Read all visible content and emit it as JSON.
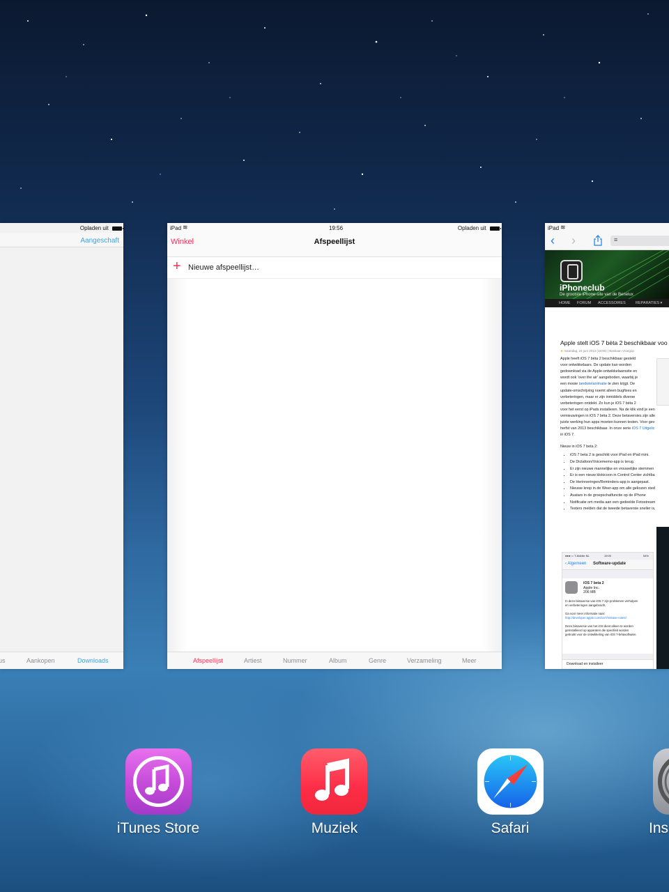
{
  "cards": {
    "itunes": {
      "status_right": "Opladen uit",
      "nav_right": "Aangeschaft",
      "tabs": [
        "us",
        "Aankopen",
        "Downloads"
      ]
    },
    "music": {
      "status_left": "iPad",
      "status_time": "19:56",
      "status_right": "Opladen uit",
      "nav_left": "Winkel",
      "nav_title": "Afspeellijst",
      "new_playlist": "Nieuwe afspeellijst…",
      "tabs": [
        "Afspeellijst",
        "Artiest",
        "Nummer",
        "Album",
        "Genre",
        "Verzameling",
        "Meer"
      ],
      "active_color": "#ff2d55"
    },
    "safari": {
      "status_left": "iPad",
      "site_name": "iPhoneclub",
      "site_tagline": "De grootste iPhone-site van de Benelux",
      "menu": [
        "HOME",
        "FORUM",
        "ACCESSOIRES",
        "REPARATIES ▾"
      ],
      "article_title": "Apple stelt iOS 7 bèta 2 beschikbaar voo",
      "article_meta": "maandag, 24 juni 2013 (18:56) | Bastiaan Vroegop",
      "paragraph_lines": [
        "Apple heeft iOS 7 bèta 2 beschikbaar gesteld",
        "voor ontwikkelaars. De update kan worden",
        "gedownload via de Apple-ontwikkelaarssite en",
        "wordt ook 'over the air' aangeboden, waarbij je",
        "een mooie ",
        "tandwielanimatie",
        " te zien krijgt. De",
        "update-omschrijving noemt alleen bugfixes en",
        "verbeteringen, maar er zijn inmiddels diverse",
        "verbeteringen ontdekt. Zo kun je iOS 7 bèta 2",
        "voor het eerst op iPads installeren. Na de klik vind je een",
        "vernieuwingen in iOS 7 bèta 2. Deze betaversies zijn alle",
        "juiste werking hun apps moeten kunnen testen. Voor gev",
        "herfst van 2013 beschikbaar. In onze serie ",
        "iOS 7 Uitgelic",
        "in iOS 7."
      ],
      "list_heading": "Nieuw in iOS 7 beta 2:",
      "list_items": [
        "iOS 7 beta 2 is geschikt voor iPad en iPad mini.",
        "De Dictafoon/Voicememo-app is terug.",
        "Er zijn nieuwe mannelijke en vrouwelijke stemmen",
        "Er is een nieuw klokicoon in Control Center zichtba",
        "De Herinneringen/Reminders-app is aangepast.",
        "Nieuwe knop in de Weer-app om alle gekozen sted",
        "Avatars in de groepschatfunctie op de iPhone",
        "Notificatie om media aan een gedeelde Fotostream",
        "Testers melden dat de tweede betaversie sneller is,"
      ],
      "shot": {
        "carrier": "●●●○○ T-Mobile NL",
        "time": "19:00",
        "battery": "54%",
        "back": "Algemeen",
        "title": "Software-update",
        "update_name": "iOS 7 beta 2",
        "update_vendor": "Apple Inc.",
        "update_size": "206 MB",
        "desc1": "In deze bètaversie van iOS 7 zijn problemen verholpen",
        "desc2": "en verbeteringen aangebracht.",
        "more1": "Ga voor meer informatie naar:",
        "more_link": "http://developer.apple.com/ios7/release-notes/",
        "desc3": "Deze bètaversie van het iOS dient alleen te worden",
        "desc4": "geïnstalleerd op apparaten die specifiek worden",
        "desc5": "gebruikt voor de ontwikkeling van iOS 7-bètasoftware.",
        "install": "Download en installeer"
      }
    }
  },
  "dock": [
    {
      "label": "iTunes Store",
      "icon": "itunes-store-icon"
    },
    {
      "label": "Muziek",
      "icon": "music-icon"
    },
    {
      "label": "Safari",
      "icon": "safari-icon"
    },
    {
      "label": "Ins",
      "icon": "settings-icon"
    }
  ]
}
